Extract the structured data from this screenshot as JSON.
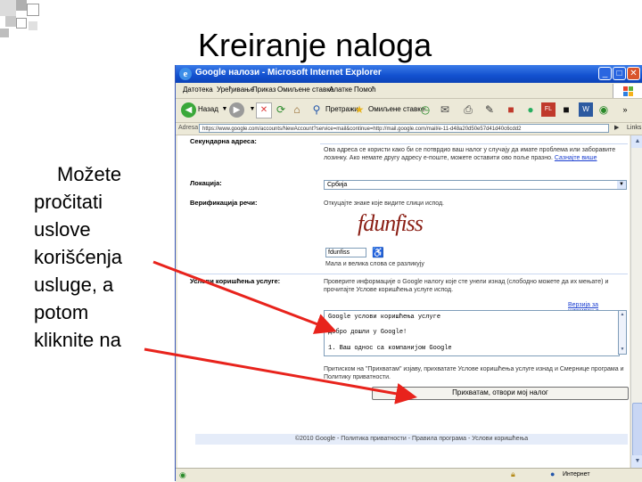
{
  "slide": {
    "title": "Kreiranje naloga",
    "text_lines": [
      "Možete",
      "pročitati",
      "uslove",
      "korišćenja",
      "usluge, a",
      "potom",
      "kliknite na"
    ]
  },
  "window": {
    "title": "Google налози - Microsoft Internet Explorer",
    "menu": [
      "Датотека",
      "Уређивање",
      "Приказ",
      "Омиљене ставке",
      "Алатке",
      "Помоћ"
    ],
    "toolbar": {
      "back_label": "Назад",
      "search_label": "Претражи",
      "favorites_label": "Омиљене ставке"
    },
    "address": {
      "label": "Adresa",
      "url": "https://www.google.com/accounts/NewAccount?service=mail&continue=http://mail.google.com/mail/e-11-d48a20d50e57d41d40c6cdd2",
      "go_label": "Иди на",
      "links_label": "Links"
    },
    "status_text": "Интернет",
    "colors": {
      "titlebar": "#1250cf",
      "link": "#1a3ed0",
      "chrome": "#ece9d8",
      "captcha": "#8a1e14"
    }
  },
  "page": {
    "secondary_email_label": "Секундарна адреса:",
    "secondary_email_help": "Ова адреса се користи како би се потврдио ваш налог у случају да имате проблема или заборавите лозинку. Ако немате другу адресу е-поште, можете оставити ово поље празно.",
    "secondary_email_link": "Сазнајте више",
    "location_label": "Локација:",
    "location_value": "Србија",
    "verification_label": "Верификација речи:",
    "verification_help": "Откуцајте знаке које видите слици испод.",
    "captcha_text": "fdunfiss",
    "captcha_input_value": "fdunfiss",
    "captcha_note": "Мала и велика слова се разликују",
    "tos_label": "Услови коришћења услуге:",
    "tos_help": "Проверите информације о Google налогу које сте унели изнад (слободно можете да их мењате) и прочитајте Услове коришћења услуге испод.",
    "print_link": "Верзија за штампање",
    "tos_box_lines": [
      "Google услови коришћења услуге",
      "Добро дошли у Google!",
      "1. Ваш однос са компанијом Google"
    ],
    "agree_text": "Притиском на \"Прихватам\" изјаву, прихватате Услове коришћења услуге изнад и Смернице програма и Политику приватности.",
    "accept_button": "Прихватам, отвори мој налог",
    "footer": "©2010 Google - Политика приватности - Правила програма - Услови коришћења"
  }
}
